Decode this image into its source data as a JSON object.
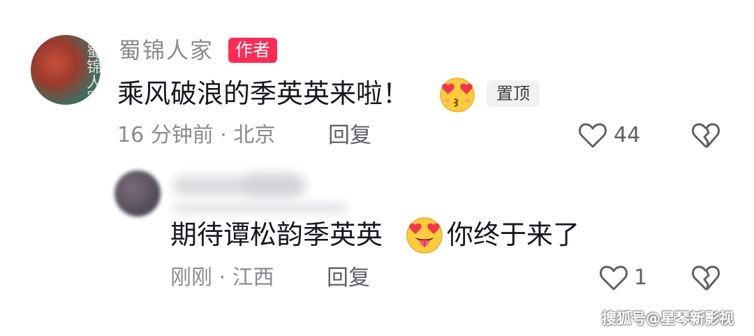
{
  "comment": {
    "author": "蜀锦人家",
    "author_badge": "作者",
    "avatar_text": "蜀锦人家",
    "text": "乘风破浪的季英英来啦！",
    "emoji": "smiling-face-with-heart-eyes-kiss",
    "pinned_label": "置顶",
    "meta": "16 分钟前 · 北京",
    "reply_label": "回复",
    "like_count": "44"
  },
  "reply": {
    "text_before_emoji": "期待谭松韵季英英",
    "emoji": "heart-eyes-tongue-out",
    "text_after_emoji": "你终于来了",
    "meta": "刚刚 · 江西",
    "reply_label": "回复",
    "like_count": "1"
  },
  "watermark": "搜狐号@星琴新影视",
  "colors": {
    "author_badge_bg": "#fe2c55",
    "muted_text": "#8a8b91",
    "body_text": "#161823"
  }
}
